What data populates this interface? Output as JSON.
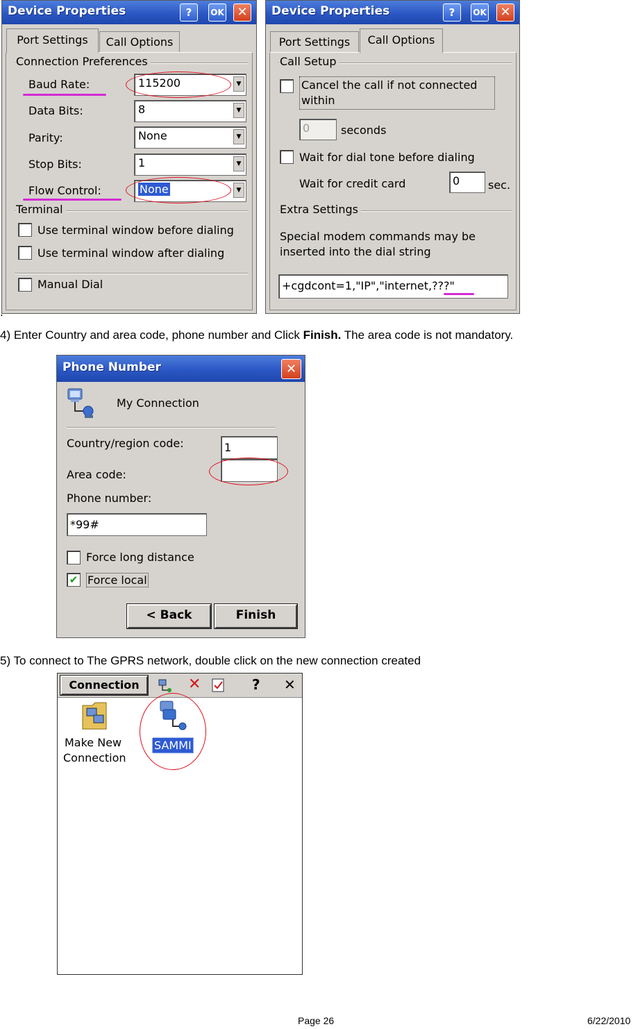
{
  "leading_mark": ".",
  "dialog1": {
    "title": "Device Properties",
    "help": "?",
    "ok": "OK",
    "close": "✕",
    "tabs": [
      "Port Settings",
      "Call Options"
    ],
    "group_connection": "Connection Preferences",
    "baud_label": "Baud Rate:",
    "baud_value": "115200",
    "databits_label": "Data Bits:",
    "databits_value": "8",
    "parity_label": "Parity:",
    "parity_value": "None",
    "stopbits_label": "Stop Bits:",
    "stopbits_value": "1",
    "flow_label": "Flow Control:",
    "flow_value": "None",
    "group_terminal": "Terminal",
    "term_before": "Use terminal window before dialing",
    "term_after": "Use terminal window after dialing",
    "manual_dial": "Manual Dial"
  },
  "dialog2": {
    "title": "Device Properties",
    "help": "?",
    "ok": "OK",
    "close": "✕",
    "tabs": [
      "Port Settings",
      "Call Options"
    ],
    "group_call_setup": "Call Setup",
    "cancel_call": "Cancel the call if not connected within",
    "seconds_value": "0",
    "seconds_label": "seconds",
    "wait_dial_tone": "Wait for dial tone before dialing",
    "wait_credit": "Wait for credit card",
    "credit_value": "0",
    "sec_label": "sec.",
    "group_extra": "Extra Settings",
    "extra_desc_1": "Special modem commands may be",
    "extra_desc_2": "inserted into the dial string",
    "extra_value": "+cgdcont=1,\"IP\",\"internet,???\""
  },
  "step4": {
    "text": "4) Enter Country and area code, phone number and Click ",
    "bold": "Finish.",
    "tail": " The area code is not mandatory."
  },
  "dialog3": {
    "title": "Phone Number",
    "close": "✕",
    "connection_name": "My Connection",
    "country_label": "Country/region code:",
    "country_value": "1",
    "area_label": "Area code:",
    "area_value": "",
    "phone_label": "Phone number:",
    "phone_value": "*99#",
    "force_long": "Force long distance",
    "force_local": "Force local",
    "back": "< Back",
    "finish": "Finish"
  },
  "step5": {
    "text": "5) To connect to The GPRS network, double click on the new connection created"
  },
  "window4": {
    "menu": "Connection",
    "help": "?",
    "close": "✕",
    "make_new_1": "Make New",
    "make_new_2": "Connection",
    "sammi": "SAMMI"
  },
  "footer": {
    "page": "Page 26",
    "date": "6/22/2010"
  },
  "colors": {
    "annotation_ellipse": "#e01020",
    "annotation_underline": "#d42bd4",
    "titlebar": "#2b57c4"
  }
}
